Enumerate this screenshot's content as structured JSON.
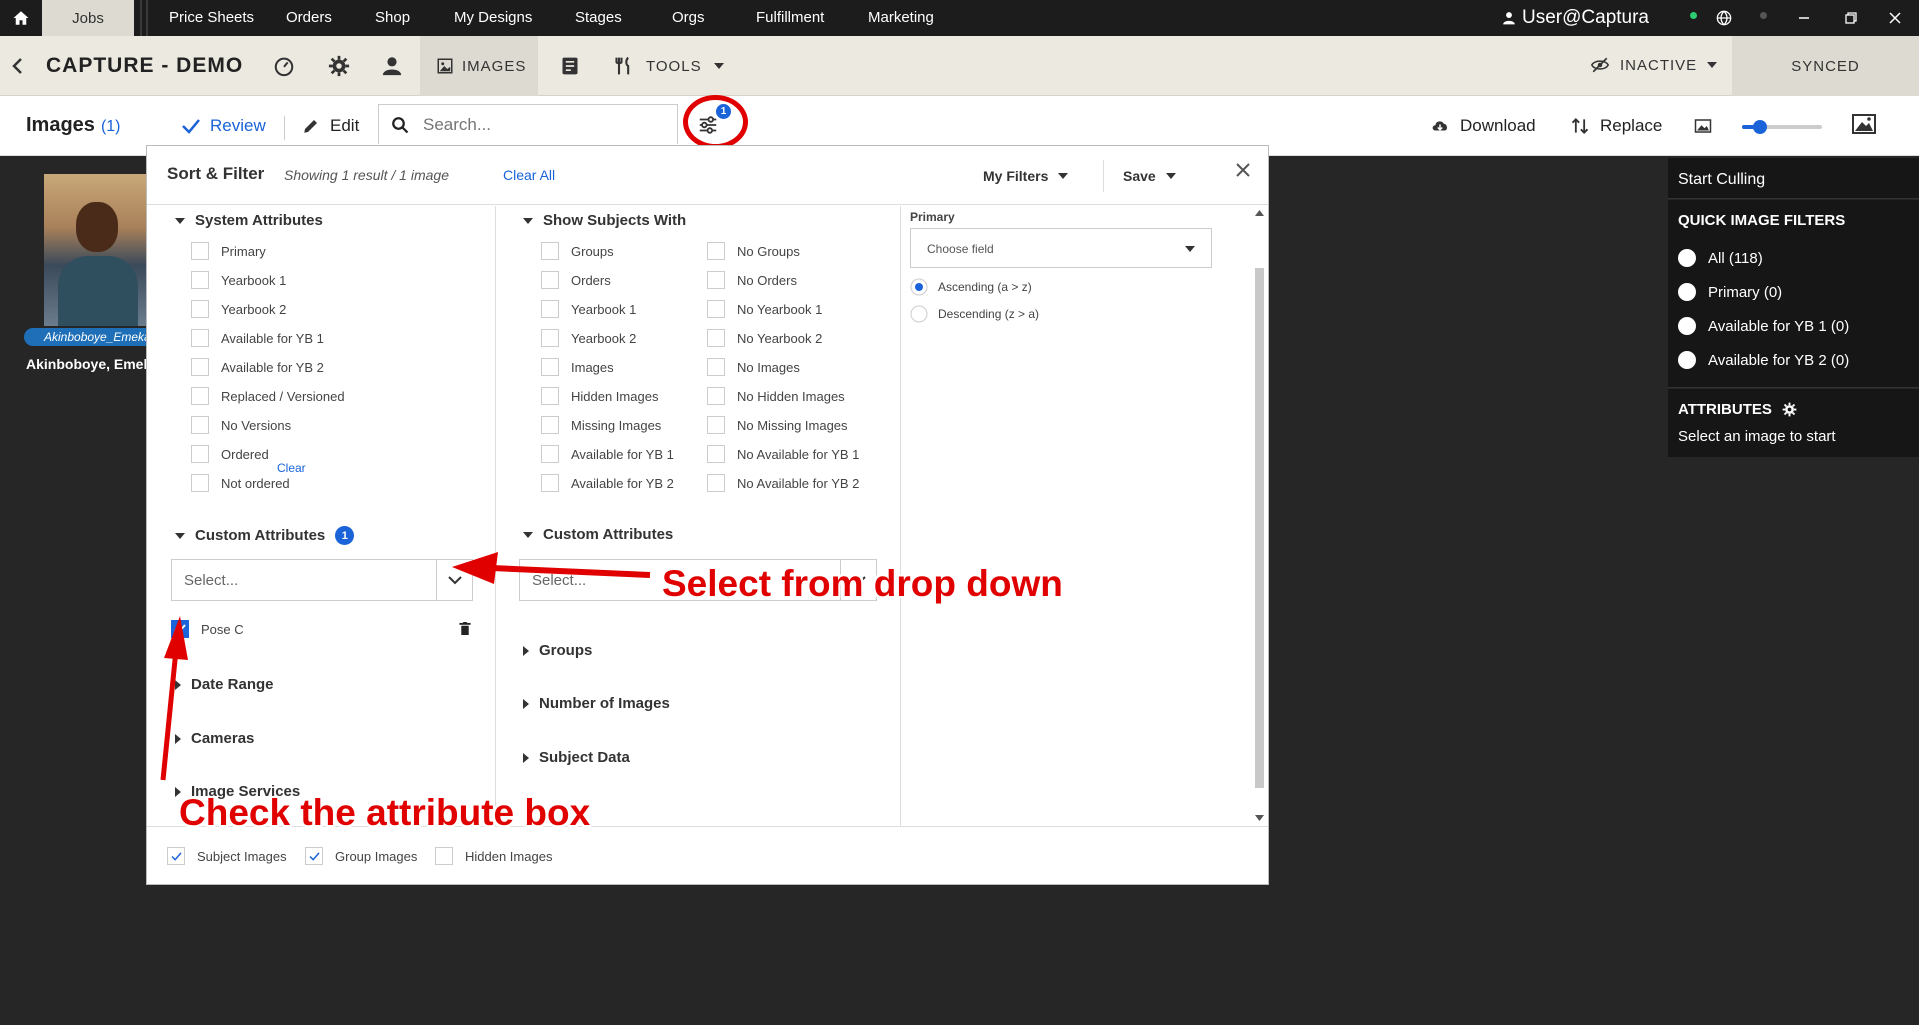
{
  "topnav": {
    "active": "Jobs",
    "items": [
      "Price Sheets",
      "Orders",
      "Shop",
      "My Designs",
      "Stages",
      "Orgs",
      "Fulfillment",
      "Marketing"
    ],
    "user": "User@Captura",
    "icons": [
      "home-icon",
      "user-icon",
      "globe-icon",
      "minimize-icon",
      "restore-icon",
      "close-icon"
    ]
  },
  "header": {
    "title": "CAPTURE - DEMO",
    "images_tab": "IMAGES",
    "tools": "TOOLS",
    "status": "INACTIVE",
    "sync": "SYNCED"
  },
  "toolbar": {
    "title": "Images",
    "count": "(1)",
    "review": "Review",
    "edit": "Edit",
    "search_placeholder": "Search...",
    "filter_badge": "1",
    "download": "Download",
    "replace": "Replace",
    "zoom_level": 0.22
  },
  "gallery": {
    "tag": "Akinboboye_Emeka",
    "name": "Akinboboye, Emeka"
  },
  "right_panel": {
    "start_culling": "Start Culling",
    "quick_filters_title": "QUICK IMAGE FILTERS",
    "quick_filters": [
      "All (118)",
      "Primary (0)",
      "Available for YB 1 (0)",
      "Available for YB 2 (0)"
    ],
    "attributes_title": "ATTRIBUTES",
    "attributes_hint": "Select an image to start"
  },
  "modal": {
    "title": "Sort & Filter",
    "showing": "Showing 1 result / 1 image",
    "clear_all": "Clear All",
    "my_filters": "My Filters",
    "save": "Save",
    "system_attributes": {
      "title": "System Attributes",
      "items": [
        "Primary",
        "Yearbook 1",
        "Yearbook 2",
        "Available for YB 1",
        "Available for YB 2",
        "Replaced / Versioned",
        "No Versions",
        "Ordered",
        "Not ordered"
      ]
    },
    "custom_attributes": {
      "title": "Custom Attributes",
      "badge": "1",
      "clear": "Clear",
      "select_placeholder": "Select...",
      "selected_item": "Pose C"
    },
    "collapsed_left": [
      "Date Range",
      "Cameras",
      "Image Services"
    ],
    "show_subjects": {
      "title": "Show Subjects With",
      "left": [
        "Groups",
        "Orders",
        "Yearbook 1",
        "Yearbook 2",
        "Images",
        "Hidden Images",
        "Missing Images",
        "Available for YB 1",
        "Available for YB 2"
      ],
      "right": [
        "No Groups",
        "No Orders",
        "No Yearbook 1",
        "No Yearbook 2",
        "No Images",
        "No Hidden Images",
        "No Missing Images",
        "No Available for YB 1",
        "No Available for YB 2"
      ]
    },
    "custom_attributes_2": {
      "title": "Custom Attributes",
      "select_placeholder": "Select..."
    },
    "collapsed_mid": [
      "Groups",
      "Number of Images",
      "Subject Data"
    ],
    "sort": {
      "label": "Primary",
      "field_placeholder": "Choose field",
      "options": [
        "Ascending (a > z)",
        "Descending (z > a)"
      ]
    },
    "footer": [
      "Subject Images",
      "Group Images",
      "Hidden Images"
    ]
  },
  "annotations": {
    "select_dropdown": "Select from drop down",
    "check_box": "Check the attribute box"
  },
  "colors": {
    "accent": "#1a63d9",
    "annotation": "#e00000",
    "dark_bg": "#262626",
    "header_bg": "#ece9e1"
  }
}
